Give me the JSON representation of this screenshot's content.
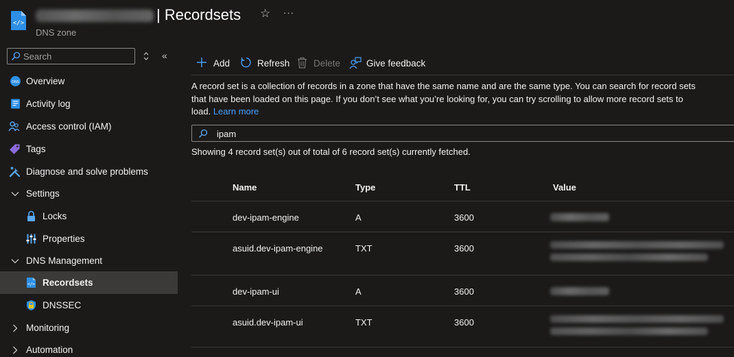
{
  "header": {
    "title": "| Recordsets",
    "subtitle": "DNS zone"
  },
  "sidebar": {
    "search_placeholder": "Search",
    "items": [
      {
        "label": "Overview"
      },
      {
        "label": "Activity log"
      },
      {
        "label": "Access control (IAM)"
      },
      {
        "label": "Tags"
      },
      {
        "label": "Diagnose and solve problems"
      },
      {
        "label": "Settings"
      },
      {
        "label": "Locks"
      },
      {
        "label": "Properties"
      },
      {
        "label": "DNS Management"
      },
      {
        "label": "Recordsets"
      },
      {
        "label": "DNSSEC"
      },
      {
        "label": "Monitoring"
      },
      {
        "label": "Automation"
      }
    ]
  },
  "toolbar": {
    "add_label": "Add",
    "refresh_label": "Refresh",
    "delete_label": "Delete",
    "feedback_label": "Give feedback"
  },
  "description": {
    "text": "A record set is a collection of records in a zone that have the same name and are the same type. You can search for record sets that have been loaded on this page. If you don’t see what you’re looking for, you can try scrolling to allow more record sets to load.",
    "link": "Learn more"
  },
  "filter": {
    "value": "ipam"
  },
  "summary": "Showing 4 record set(s) out of total of 6 record set(s) currently fetched.",
  "table": {
    "columns": [
      "Name",
      "Type",
      "TTL",
      "Value"
    ],
    "rows": [
      {
        "name": "dev-ipam-engine",
        "type": "A",
        "ttl": "3600"
      },
      {
        "name": "asuid.dev-ipam-engine",
        "type": "TXT",
        "ttl": "3600"
      },
      {
        "name": "dev-ipam-ui",
        "type": "A",
        "ttl": "3600"
      },
      {
        "name": "asuid.dev-ipam-ui",
        "type": "TXT",
        "ttl": "3600"
      }
    ]
  },
  "colors": {
    "background": "#1b1a19",
    "accent": "#4aa0f5",
    "selected_nav": "#3b3a39"
  }
}
